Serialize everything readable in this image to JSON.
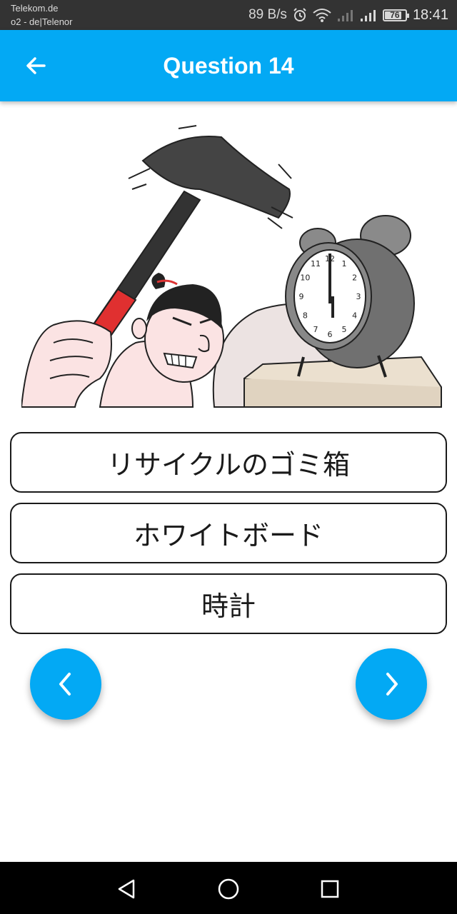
{
  "status_bar": {
    "carrier_1": "Telekom.de",
    "carrier_2": "o2 - de|Telenor",
    "net_speed": "89 B/s",
    "battery": "76",
    "time": "18:41",
    "icons": [
      "alarm-icon",
      "wifi-icon",
      "signal-icon",
      "signal-icon",
      "battery-icon"
    ]
  },
  "app_bar": {
    "title": "Question 14",
    "back_icon": "arrow-left-icon"
  },
  "illustration": {
    "alarm_clock_numerals": [
      "12",
      "1",
      "2",
      "3",
      "4",
      "5",
      "6",
      "7",
      "8",
      "9",
      "10",
      "11"
    ]
  },
  "answers": [
    {
      "label": "リサイクルのゴミ箱"
    },
    {
      "label": "ホワイトボード"
    },
    {
      "label": "時計"
    }
  ],
  "navigation": {
    "prev_icon": "chevron-left-icon",
    "next_icon": "chevron-right-icon"
  },
  "system_nav": {
    "icons": [
      "triangle-back-icon",
      "circle-home-icon",
      "square-recents-icon"
    ]
  },
  "colors": {
    "accent": "#03a9f4",
    "status_bar": "#333333",
    "nav_bar": "#000000"
  }
}
